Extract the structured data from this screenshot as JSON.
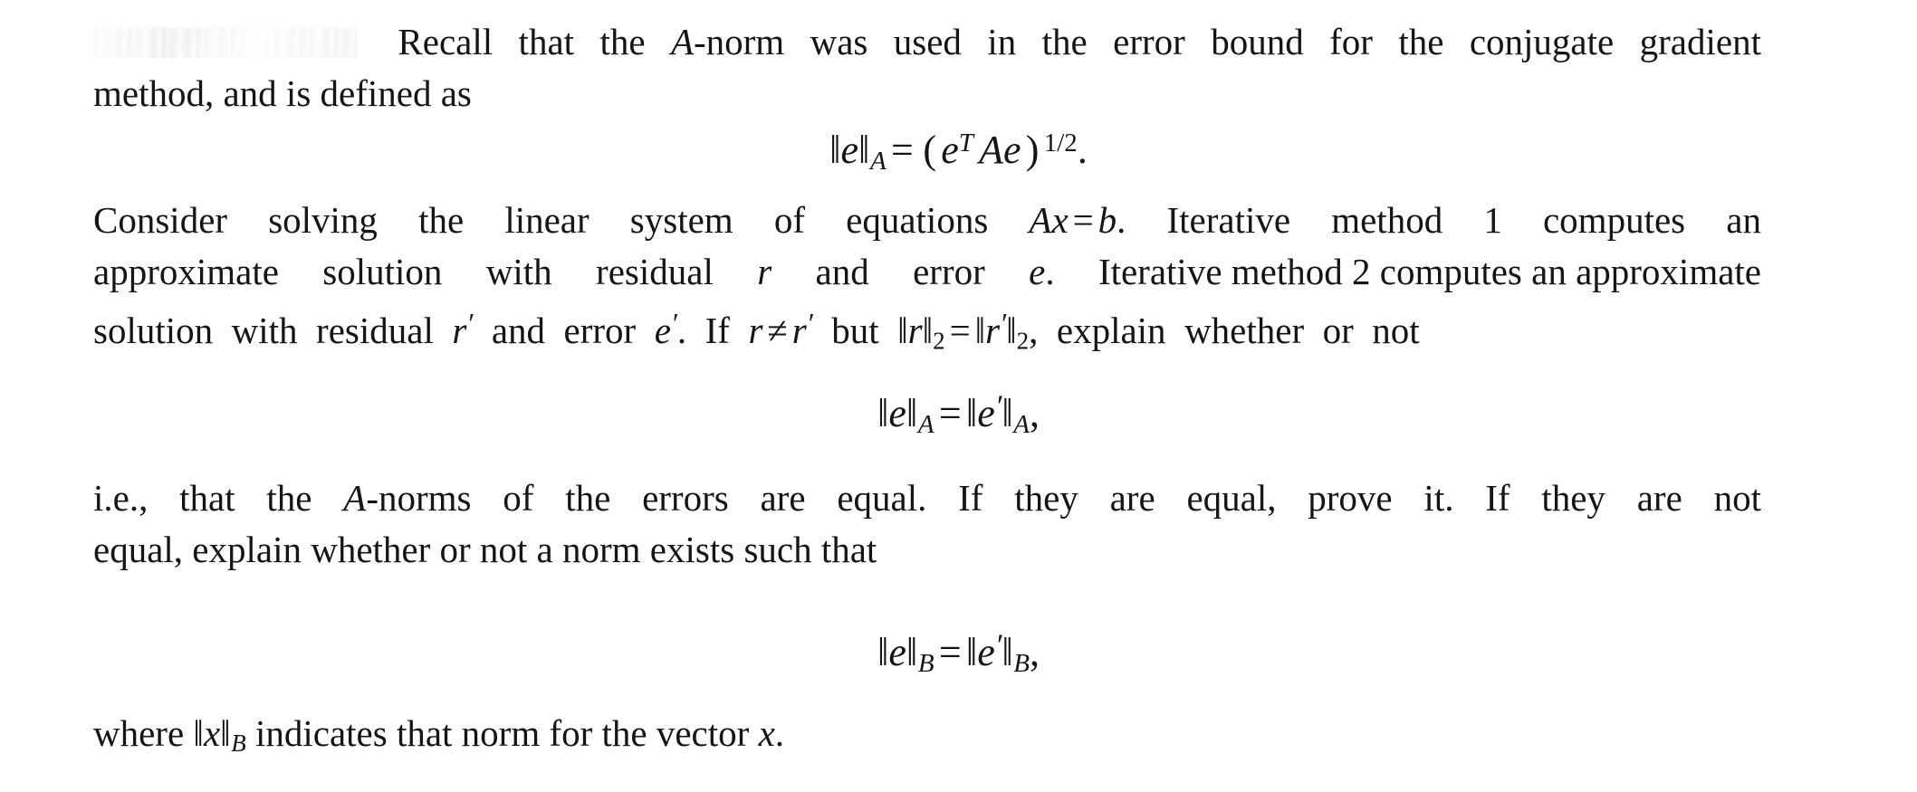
{
  "document": {
    "type": "math-homework-problem",
    "background_color": "#ffffff",
    "text_color": "#151515",
    "redacted_label": {
      "present": true,
      "description": "whited-out / faded problem label at start of first paragraph"
    },
    "paragraphs": [
      {
        "id": "intro",
        "lines": [
          "Recall that the A-norm was used in the error bound for the conjugate gradient",
          "method, and is defined as"
        ],
        "words": {
          "l1a": "Recall",
          "l1b": "that",
          "l1c": "the",
          "l1d": "A",
          "l1e": "-norm",
          "l1f": "was",
          "l1g": "used",
          "l1h": "in",
          "l1i": "the",
          "l1j": "error",
          "l1k": "bound",
          "l1l": "for",
          "l1m": "the",
          "l1n": "conjugate",
          "l1o": "gradient",
          "l2": "method, and is defined as"
        }
      },
      {
        "id": "consider",
        "lines": [
          "Consider solving the linear system of equations Ax = b.  Iterative method 1 computes an",
          "approximate solution with residual r and error e.  Iterative method 2 computes an approximate",
          "solution with residual r' and error e'. If r ≠ r' but ||r||2 = ||r'||2, explain whether or not"
        ],
        "words": {
          "c1": "Consider",
          "c2": "solving",
          "c3": "the",
          "c4": "linear",
          "c5": "system",
          "c6": "of",
          "c7": "equations",
          "c8": "Iterative",
          "c9": "method",
          "c10": "1",
          "c11": "computes",
          "c12": "an",
          "d1": "approximate",
          "d2": "solution",
          "d3": "with",
          "d4": "residual",
          "d5": "and",
          "d6": "error",
          "d7": "Iterative method 2 computes an approximate",
          "e1": "solution",
          "e2": "with",
          "e3": "residual",
          "e4": "and",
          "e5": "error",
          "e6": "If",
          "e7": "but",
          "e8": "explain",
          "e9": "whether",
          "e10": "or",
          "e11": "not"
        }
      },
      {
        "id": "ie",
        "lines": [
          "i.e., that the A-norms of the errors are equal.  If they are equal, prove it.  If they are not",
          "equal, explain whether or not a norm exists such that"
        ],
        "words": {
          "f1": "i.e.,",
          "f2": "that",
          "f3": "the",
          "f4": "A",
          "f5": "-norms",
          "f6": "of",
          "f7": "the",
          "f8": "errors",
          "f9": "are",
          "f10": "equal.",
          "f11": "If",
          "f12": "they",
          "f13": "are",
          "f14": "equal,",
          "f15": "prove",
          "f16": "it.",
          "f17": "If",
          "f18": "they",
          "f19": "are",
          "f20": "not",
          "g1": "equal, explain whether or not a norm exists such that"
        }
      },
      {
        "id": "where",
        "lines": [
          "where ||x||B indicates that norm for the vector x."
        ],
        "words": {
          "h1": "where",
          "h2": "indicates that norm for the vector",
          "h3": "."
        }
      }
    ],
    "equations": [
      {
        "id": "eq1",
        "latex": "\\|e\\|_A = (e^T A e)^{1/2}.",
        "parts": {
          "lhs_norm_open": "‖",
          "lhs_var": "e",
          "lhs_norm_close": "‖",
          "lhs_sub": "A",
          "rel": "=",
          "paren_open": "(",
          "rhs_e1": "e",
          "rhs_sup_T": "T",
          "rhs_A": "A",
          "rhs_e2": "e",
          "paren_close": ")",
          "rhs_exp": "1/2",
          "period": "."
        }
      },
      {
        "id": "eq2",
        "latex": "\\|e\\|_A = \\|e'\\|_A,",
        "parts": {
          "lhs_norm_open": "‖",
          "lhs_var": "e",
          "lhs_norm_close": "‖",
          "lhs_sub": "A",
          "rel": "=",
          "rhs_norm_open": "‖",
          "rhs_var": "e",
          "rhs_prime": "′",
          "rhs_norm_close": "‖",
          "rhs_sub": "A",
          "comma": ","
        }
      },
      {
        "id": "eq3",
        "latex": "\\|e\\|_B = \\|e'\\|_B,",
        "parts": {
          "lhs_norm_open": "‖",
          "lhs_var": "e",
          "lhs_norm_close": "‖",
          "lhs_sub": "B",
          "rel": "=",
          "rhs_norm_open": "‖",
          "rhs_var": "e",
          "rhs_prime": "′",
          "rhs_norm_close": "‖",
          "rhs_sub": "B",
          "comma": ","
        }
      }
    ],
    "inline_math": {
      "A_italic": "A",
      "Ax": "Ax",
      "eq_rel": "=",
      "b": "b",
      "period": ".",
      "r": "r",
      "e": "e",
      "e_period": "e",
      "r_prime_var": "r",
      "prime": "′",
      "e_prime_var": "e",
      "neq": "≠",
      "norm_bar": "‖",
      "sub_two": "2",
      "comma": ",",
      "x": "x",
      "sub_B": "B"
    }
  }
}
